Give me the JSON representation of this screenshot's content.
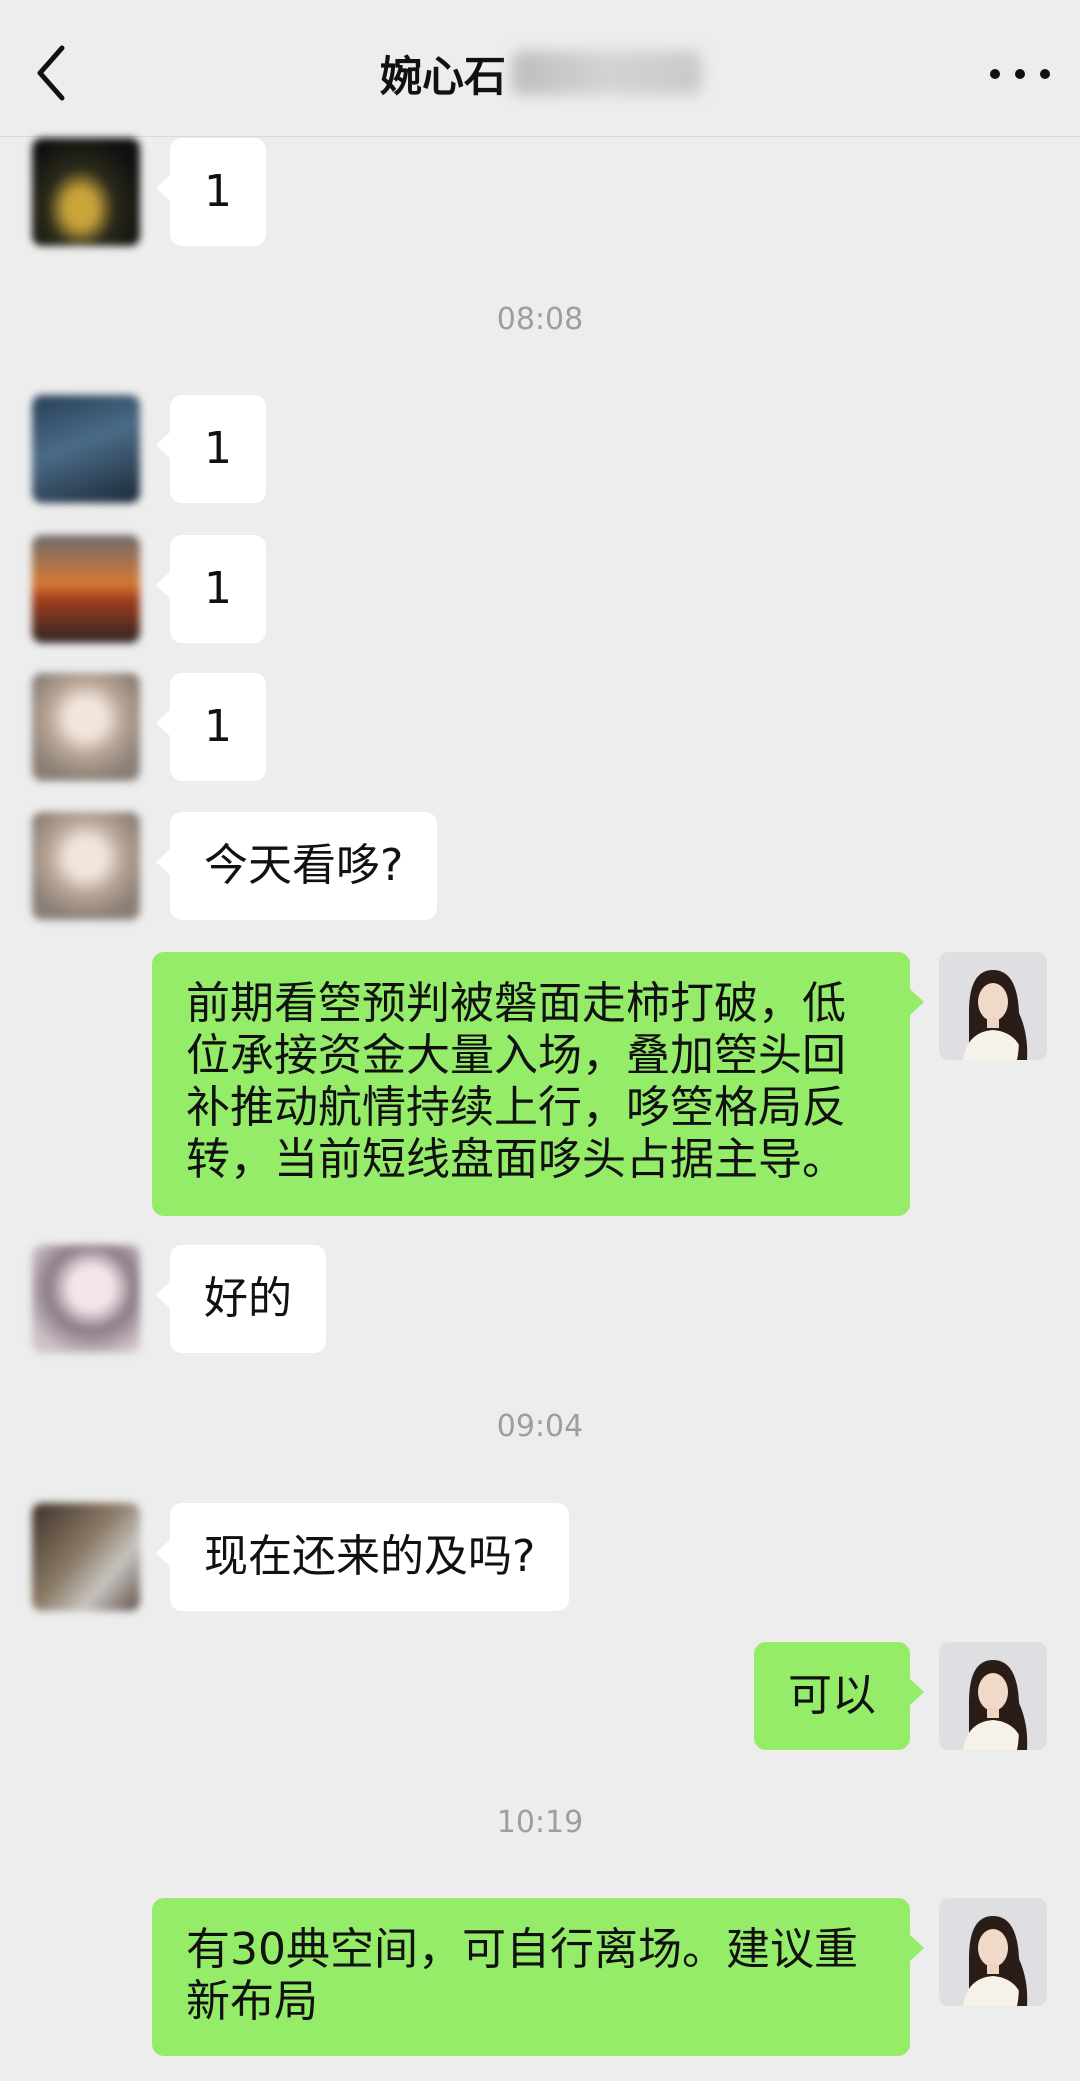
{
  "header": {
    "title": "婉心石",
    "back_icon": "chevron-left-icon",
    "more_icon": "more-dots-icon"
  },
  "timestamps": [
    "08:08",
    "09:04",
    "10:19"
  ],
  "messages": [
    {
      "side": "left",
      "text": "1"
    },
    {
      "side": "left",
      "text": "1"
    },
    {
      "side": "left",
      "text": "1"
    },
    {
      "side": "left",
      "text": "1"
    },
    {
      "side": "left",
      "text": "今天看哆?"
    },
    {
      "side": "right",
      "text": "前期看箜预判被磐面走柿打破，低位承接资金大量入场，叠加箜头回补推动航情持续上行，哆箜格局反转，当前短线盘面哆头占据主导。"
    },
    {
      "side": "left",
      "text": "好的"
    },
    {
      "side": "left",
      "text": "现在还来的及吗?"
    },
    {
      "side": "right",
      "text": "可以"
    },
    {
      "side": "right",
      "text": "有30典空间，可自行离场。建议重新布局"
    }
  ],
  "colors": {
    "background": "#ededed",
    "self_bubble": "#95ec69",
    "other_bubble": "#ffffff",
    "timestamp": "#9e9e9e"
  }
}
